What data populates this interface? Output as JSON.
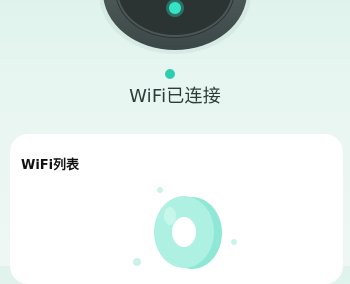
{
  "status": {
    "text": "WiFi已连接",
    "accent_color": "#2fcdb0",
    "icon": "wifi-router-icon"
  },
  "wifi_list": {
    "title": "WiFi列表",
    "empty_icon": "empty-ring-icon"
  }
}
